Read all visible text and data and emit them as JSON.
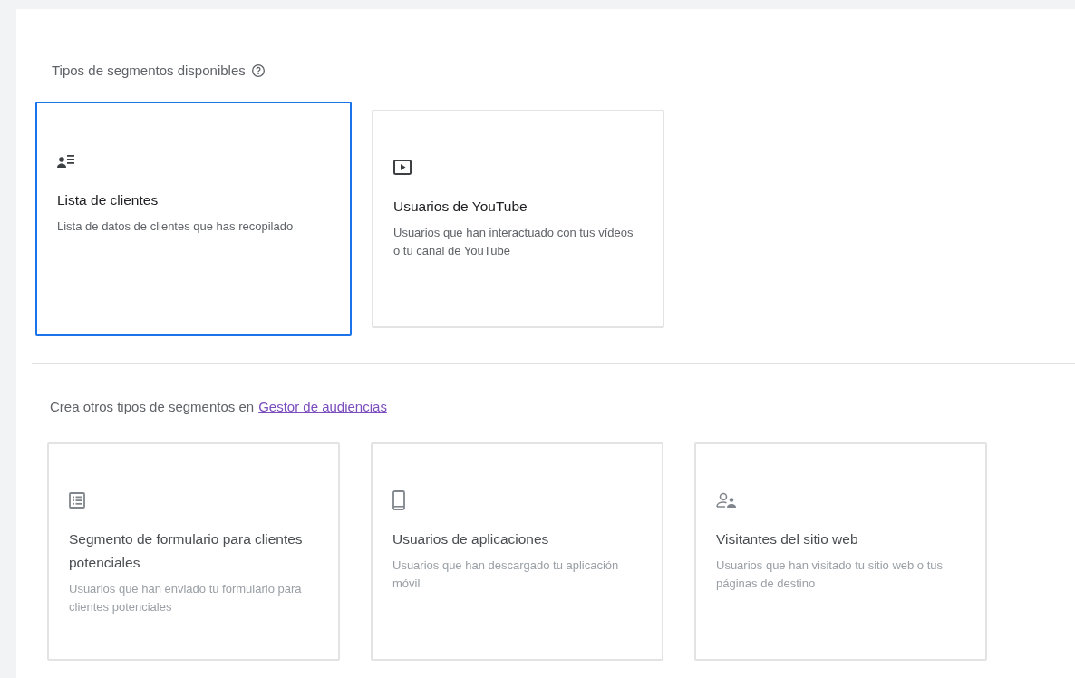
{
  "available": {
    "heading": "Tipos de segmentos disponibles",
    "cards": [
      {
        "kind": "contacts",
        "title": "Lista de clientes",
        "description": "Lista de datos de clientes que has recopilado",
        "selected": true,
        "disabled": false
      },
      {
        "kind": "video",
        "title": "Usuarios de YouTube",
        "description": "Usuarios que han interactuado con tus vídeos o tu canal de YouTube",
        "selected": false,
        "disabled": false
      }
    ]
  },
  "other": {
    "text": "Crea otros tipos de segmentos en",
    "link": "Gestor de audiencias",
    "cards": [
      {
        "kind": "form",
        "title": "Segmento de formulario para clientes potenciales",
        "description": "Usuarios que han enviado tu formulario para clientes potenciales",
        "selected": false,
        "disabled": true
      },
      {
        "kind": "phone",
        "title": "Usuarios de aplicaciones",
        "description": "Usuarios que han descargado tu aplicación móvil",
        "selected": false,
        "disabled": true
      },
      {
        "kind": "visitors",
        "title": "Visitantes del sitio web",
        "description": "Usuarios que han visitado tu sitio web o tus páginas de destino",
        "selected": false,
        "disabled": true
      }
    ]
  }
}
